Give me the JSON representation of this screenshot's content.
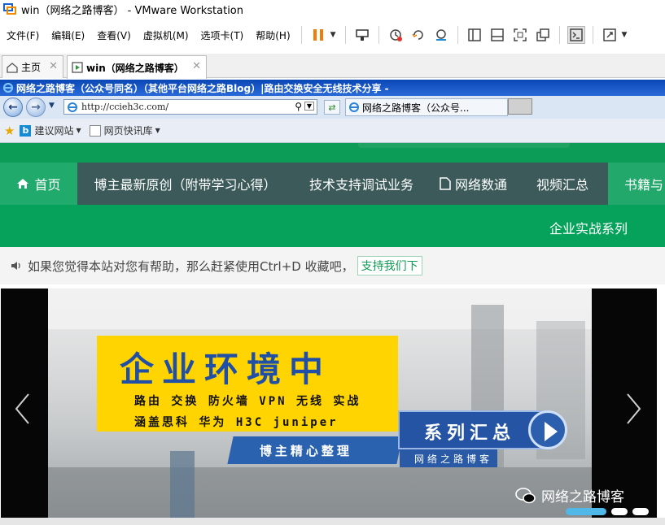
{
  "window": {
    "title": "win（网络之路博客） - VMware Workstation"
  },
  "menu": {
    "items": [
      {
        "label": "文件(F)",
        "name": "menu-file"
      },
      {
        "label": "编辑(E)",
        "name": "menu-edit"
      },
      {
        "label": "查看(V)",
        "name": "menu-view"
      },
      {
        "label": "虚拟机(M)",
        "name": "menu-vm"
      },
      {
        "label": "选项卡(T)",
        "name": "menu-tabs"
      },
      {
        "label": "帮助(H)",
        "name": "menu-help"
      }
    ]
  },
  "toolbar": {
    "icons": [
      "pause-icon",
      "send-keys-icon",
      "snapshot-icon",
      "revert-snapshot-icon",
      "snapshot-manager-icon",
      "sidebar-icon",
      "thumbnail-icon",
      "fullscreen-icon",
      "unity-icon",
      "console-icon",
      "stretch-icon"
    ],
    "accent": "#f07c0a"
  },
  "vm_tabs": [
    {
      "label": "主页",
      "active": false
    },
    {
      "label": "win（网络之路博客）",
      "active": true
    }
  ],
  "browser": {
    "window_title": "网络之路博客（公众号同名）（其他平台网络之路Blog）|路由交换安全无线技术分享 -",
    "address": "http://ccieh3c.com/",
    "tab_label": "网络之路博客（公众号...",
    "favorites": [
      {
        "label": "建议网站",
        "icon": "bing-icon"
      },
      {
        "label": "网页快讯库",
        "icon": "web-slice-icon"
      }
    ]
  },
  "site": {
    "nav": [
      {
        "label": "首页",
        "icon": "home-icon"
      },
      {
        "label": "博主最新原创（附带学习心得）",
        "icon": ""
      },
      {
        "label": "技术支持调试业务",
        "icon": ""
      },
      {
        "label": "网络数通",
        "icon": "file-icon"
      },
      {
        "label": "视频汇总",
        "icon": ""
      },
      {
        "label": "书籍与",
        "icon": ""
      }
    ],
    "subnav": [
      "企业实战系列"
    ],
    "notice": "如果您觉得本站对您有帮助，那么赶紧使用Ctrl+D 收藏吧，",
    "notice_link": "支持我们下",
    "colors": {
      "green": "#22a86a",
      "dark_nav": "#3b5a59",
      "sub_green": "#06a25b"
    }
  },
  "banner": {
    "headline": "企业环境中",
    "line1": "路由 交换 防火墙 VPN 无线 实战",
    "line2": "涵盖思科 华为 H3C juniper",
    "tag": "博主精心整理",
    "series": "系列汇总",
    "series_sub": "网络之路博客",
    "watermark": "网络之路博客",
    "colors": {
      "yellow": "#ffd400",
      "blue": "#2454a3"
    }
  }
}
